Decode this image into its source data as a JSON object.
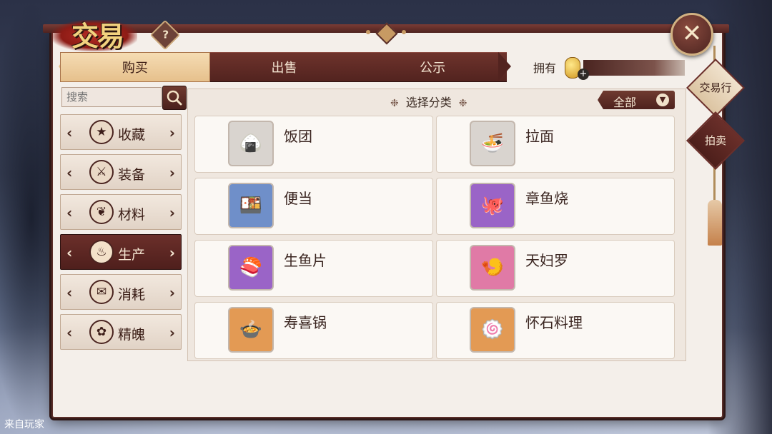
{
  "window": {
    "title": "交易",
    "help_label": "?",
    "close_label": "✕"
  },
  "tabs": [
    {
      "label": "购买",
      "active": true
    },
    {
      "label": "出售",
      "active": false
    },
    {
      "label": "公示",
      "active": false
    }
  ],
  "currency": {
    "owned_label": "拥有",
    "coin_icon": "gold-coin-icon",
    "add_icon": "plus-icon"
  },
  "search": {
    "placeholder": "搜索",
    "icon": "search-icon"
  },
  "sidebar": {
    "items": [
      {
        "label": "收藏",
        "icon": "star-icon",
        "glyph": "★",
        "active": false
      },
      {
        "label": "装备",
        "icon": "swords-icon",
        "glyph": "⚔",
        "active": false
      },
      {
        "label": "材料",
        "icon": "herb-icon",
        "glyph": "❦",
        "active": false
      },
      {
        "label": "生产",
        "icon": "teapot-icon",
        "glyph": "♨",
        "active": true
      },
      {
        "label": "消耗",
        "icon": "scroll-icon",
        "glyph": "✉",
        "active": false
      },
      {
        "label": "精魄",
        "icon": "spirit-flower-icon",
        "glyph": "✿",
        "active": false
      }
    ]
  },
  "category_header": {
    "title": "选择分类",
    "filter_value": "全部",
    "filter_icon": "chevron-down-icon"
  },
  "items": [
    {
      "name": "饭团",
      "icon": "onigiri-icon",
      "glyph": "🍙",
      "frame": "#d9d4cf"
    },
    {
      "name": "拉面",
      "icon": "ramen-icon",
      "glyph": "🍜",
      "frame": "#d9d4cf"
    },
    {
      "name": "便当",
      "icon": "bento-icon",
      "glyph": "🍱",
      "frame": "#6f8fc9"
    },
    {
      "name": "章鱼烧",
      "icon": "takoyaki-icon",
      "glyph": "🐙",
      "frame": "#9a64c7"
    },
    {
      "name": "生鱼片",
      "icon": "sashimi-icon",
      "glyph": "🍣",
      "frame": "#9a64c7"
    },
    {
      "name": "天妇罗",
      "icon": "tempura-icon",
      "glyph": "🍤",
      "frame": "#e07aa6"
    },
    {
      "name": "寿喜锅",
      "icon": "sukiyaki-icon",
      "glyph": "🍲",
      "frame": "#e39a54"
    },
    {
      "name": "怀石料理",
      "icon": "kaiseki-icon",
      "glyph": "🍥",
      "frame": "#e39a54"
    }
  ],
  "side_buttons": [
    {
      "label": "交易行",
      "active": false
    },
    {
      "label": "拍卖",
      "active": true
    }
  ],
  "watermark": "来自玩家"
}
